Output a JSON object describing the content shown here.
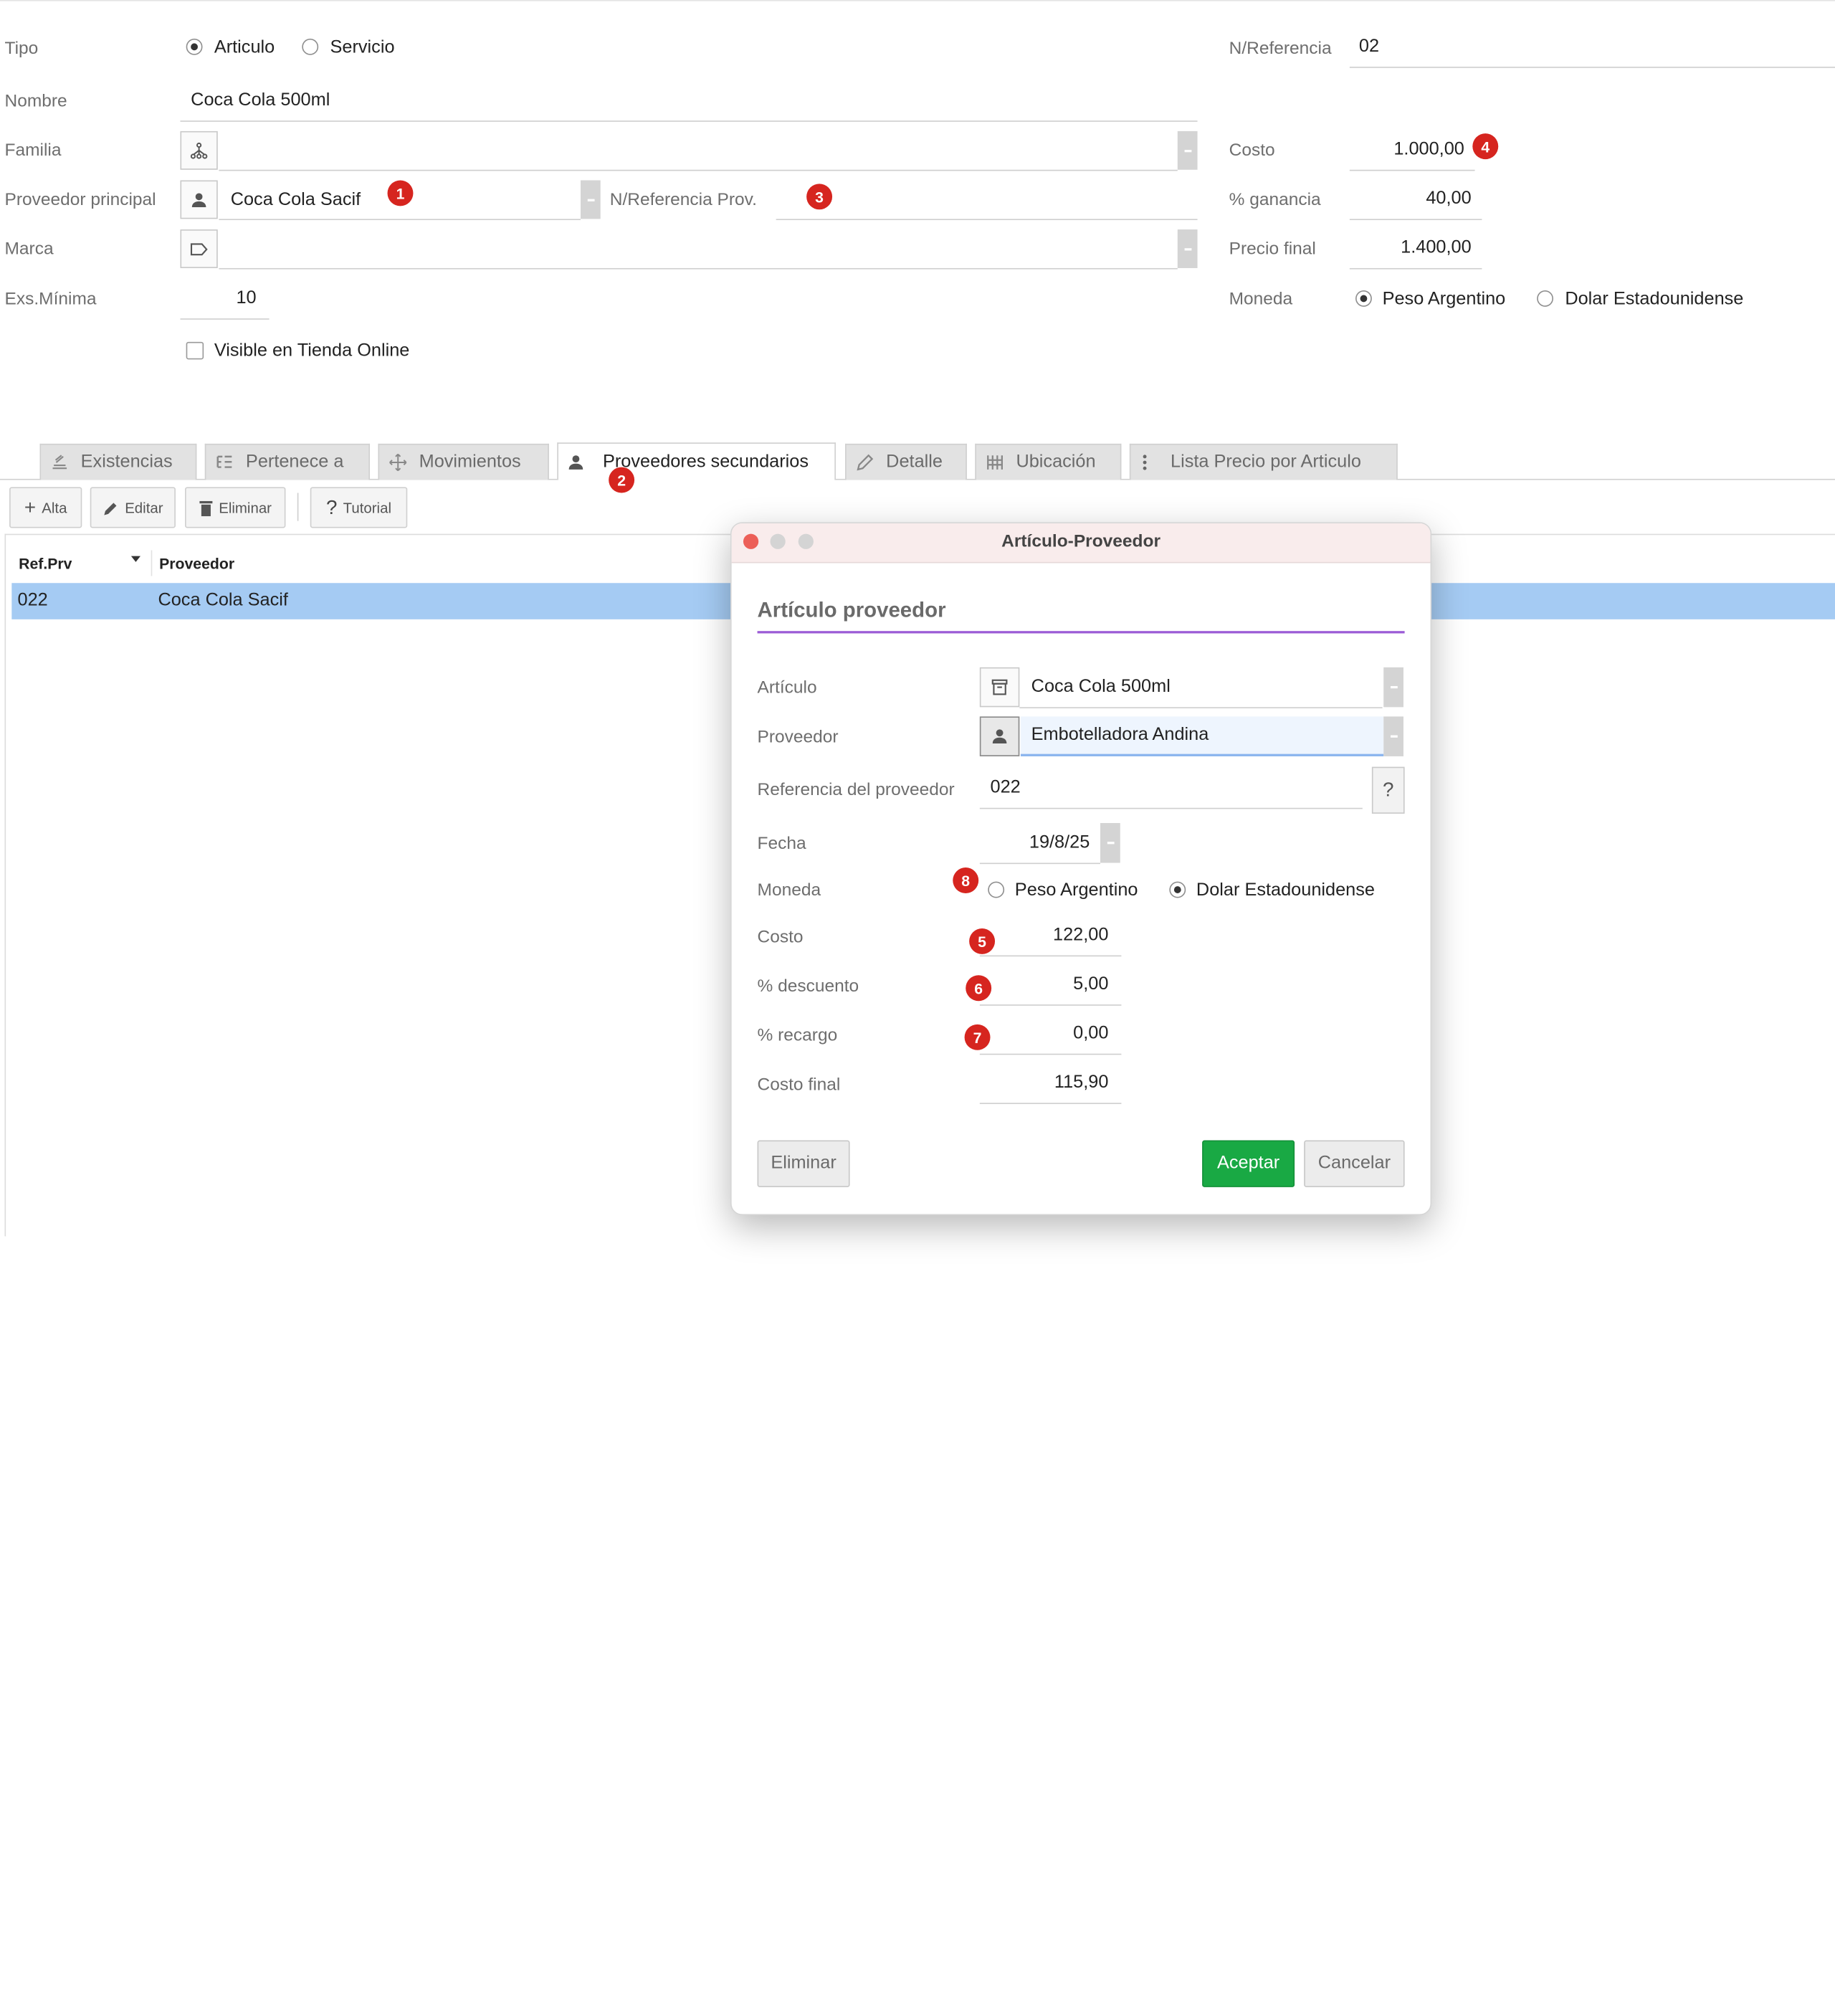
{
  "form": {
    "tipo_label": "Tipo",
    "tipo_opt1": "Articulo",
    "tipo_opt2": "Servicio",
    "nombre_label": "Nombre",
    "nombre_value": "Coca Cola 500ml",
    "familia_label": "Familia",
    "proveedor_label": "Proveedor principal",
    "proveedor_value": "Coca Cola Sacif",
    "nref_prov_label": "N/Referencia Prov.",
    "marca_label": "Marca",
    "exs_label": "Exs.Mínima",
    "exs_value": "10",
    "visible_label": "Visible en Tienda Online",
    "nref_label": "N/Referencia",
    "nref_value": "02",
    "costo_label": "Costo",
    "costo_value": "1.000,00",
    "ganancia_label": "% ganancia",
    "ganancia_value": "40,00",
    "precio_label": "Precio final",
    "precio_value": "1.400,00",
    "moneda_label": "Moneda",
    "moneda_opt1": "Peso Argentino",
    "moneda_opt2": "Dolar Estadounidense"
  },
  "badges": {
    "b1": "1",
    "b2": "2",
    "b3": "3",
    "b4": "4",
    "b5": "5",
    "b6": "6",
    "b7": "7",
    "b8": "8"
  },
  "tabs": {
    "t1": "Existencias",
    "t2": "Pertenece a",
    "t3": "Movimientos",
    "t4": "Proveedores secundarios",
    "t5": "Detalle",
    "t6": "Ubicación",
    "t7": "Lista Precio por Articulo"
  },
  "toolbar": {
    "alta": "Alta",
    "editar": "Editar",
    "eliminar": "Eliminar",
    "tutorial": "Tutorial"
  },
  "table": {
    "col1": "Ref.Prv",
    "col2": "Proveedor",
    "rows": [
      {
        "ref": "022",
        "prov": "Coca Cola Sacif"
      }
    ]
  },
  "dialog": {
    "title": "Artículo-Proveedor",
    "heading": "Artículo proveedor",
    "articulo_label": "Artículo",
    "articulo_value": "Coca Cola 500ml",
    "proveedor_label": "Proveedor",
    "proveedor_value": "Embotelladora Andina",
    "ref_label": "Referencia del proveedor",
    "ref_value": "022",
    "help": "?",
    "fecha_label": "Fecha",
    "fecha_value": "19/8/25",
    "moneda_label": "Moneda",
    "moneda_opt1": "Peso Argentino",
    "moneda_opt2": "Dolar Estadounidense",
    "costo_label": "Costo",
    "costo_value": "122,00",
    "descuento_label": "% descuento",
    "descuento_value": "5,00",
    "recargo_label": "% recargo",
    "recargo_value": "0,00",
    "final_label": "Costo final",
    "final_value": "115,90",
    "eliminar": "Eliminar",
    "aceptar": "Aceptar",
    "cancelar": "Cancelar"
  },
  "colors": {
    "badge": "#d6251f",
    "selection": "#a5cbf3",
    "accept": "#19a944",
    "heading_line": "#9b5cd6"
  }
}
